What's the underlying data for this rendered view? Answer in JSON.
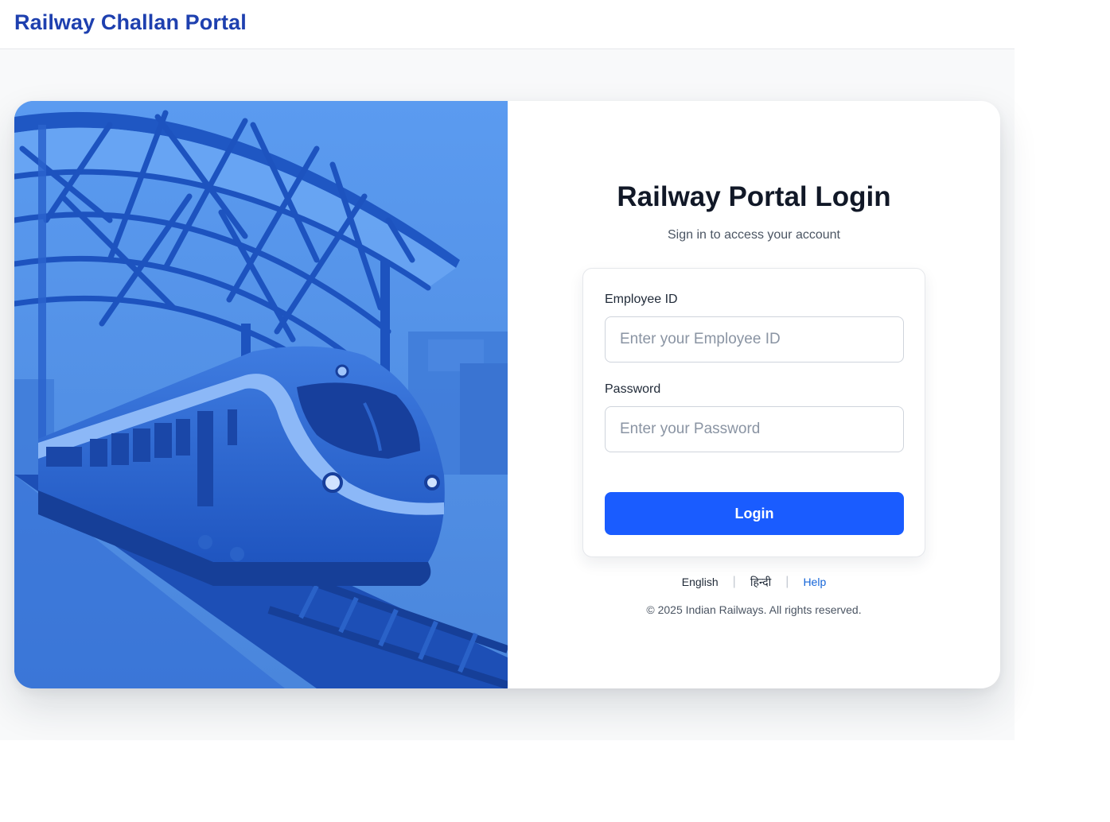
{
  "header": {
    "brand": "Railway Challan Portal"
  },
  "hero": {
    "illustration": "train-at-station-illustration"
  },
  "login": {
    "title": "Railway Portal Login",
    "subtitle": "Sign in to access your account",
    "employee_id": {
      "label": "Employee ID",
      "placeholder": "Enter your Employee ID",
      "value": ""
    },
    "password": {
      "label": "Password",
      "placeholder": "Enter your Password",
      "value": ""
    },
    "submit_label": "Login"
  },
  "footer": {
    "languages": [
      "English",
      "हिन्दी"
    ],
    "help_label": "Help",
    "copyright": "© 2025 Indian Railways. All rights reserved."
  },
  "colors": {
    "brand": "#1e40af",
    "primary_button": "#1a5cff",
    "help_link": "#1565d8",
    "hero_blue": "#4a87e0"
  }
}
